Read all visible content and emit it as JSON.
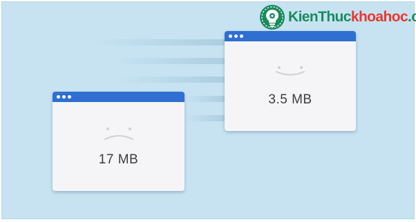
{
  "logo": {
    "part1": "KienThuc",
    "part2": "khoahoc",
    "part3": ".org",
    "icon": "lightbulb-gear-icon",
    "colors": {
      "green": "#1a8a5c",
      "red": "#e8382f"
    }
  },
  "windows": [
    {
      "id": "large-page",
      "size_label": "17 MB",
      "mood": "sad",
      "titlebar_color": "#2f6fd1"
    },
    {
      "id": "small-page",
      "size_label": "3.5 MB",
      "mood": "happy",
      "titlebar_color": "#2f6fd1"
    }
  ],
  "background_color": "#c7e3f2"
}
